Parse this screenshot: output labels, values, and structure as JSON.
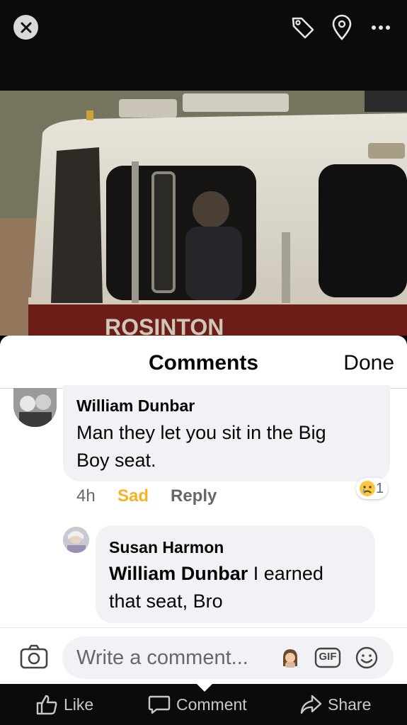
{
  "viewer": {
    "close_icon": "close-icon",
    "tag_icon": "tag-icon",
    "location_icon": "location-pin-icon",
    "more_icon": "more-icon"
  },
  "photo": {
    "sign_text": "ROSINTON"
  },
  "comments": {
    "title": "Comments",
    "done_label": "Done",
    "items": [
      {
        "author": "William Dunbar",
        "text_line1": "Man they let you sit in the Big",
        "text_line2": "Boy seat.",
        "time": "4h",
        "reaction_label": "Sad",
        "reply_label": "Reply",
        "reaction_count": "1"
      },
      {
        "author": "Susan Harmon",
        "mention": "William Dunbar",
        "text_line1_rest": " I earned",
        "text_line2": "that seat, Bro"
      }
    ]
  },
  "composer": {
    "placeholder": "Write a comment...",
    "gif_label": "GIF"
  },
  "actions": {
    "like": "Like",
    "comment": "Comment",
    "share": "Share"
  },
  "colors": {
    "sad_reaction": "#f7b125",
    "bubble": "#f0f2f5",
    "secondary_text": "#65676b"
  }
}
